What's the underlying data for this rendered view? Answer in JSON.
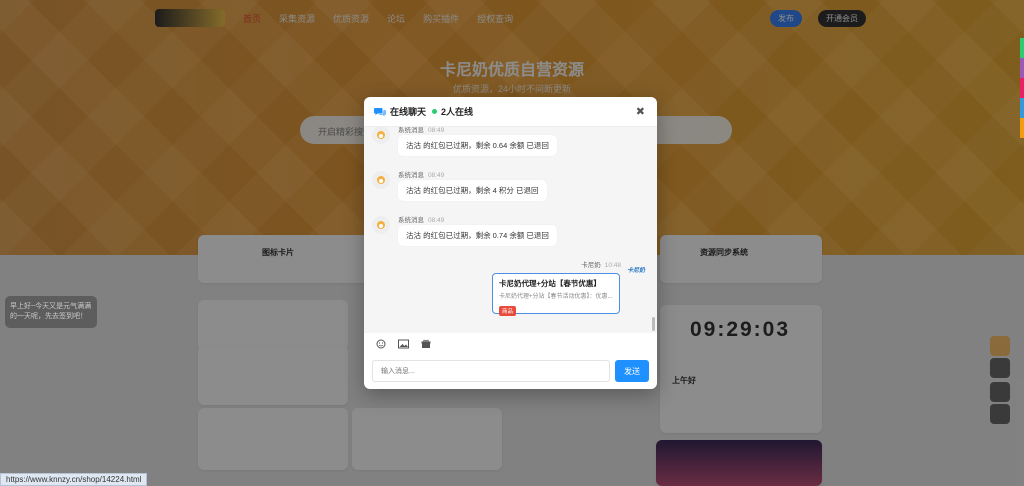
{
  "status_url": "https://www.knnzy.cn/shop/14224.html",
  "background": {
    "hero_title": "卡尼奶优质自营资源",
    "hero_sub": "优质资源，24小时不间断更新",
    "search_placeholder": "开启精彩搜索",
    "left_tip": "早上好~今天又是元气满满的一天呢，先去签到吧！",
    "clock": "09:29:03",
    "card_title_1": "图标卡片",
    "card_title_2": "资源同步系统",
    "greeting": "上午好"
  },
  "chat": {
    "title": "在线聊天",
    "online_text": "2人在线",
    "messages": [
      {
        "sender": "系统消息",
        "time": "08:49",
        "text": "沽沽 的红包已过期，剩余 0.64 余额 已退回"
      },
      {
        "sender": "系统消息",
        "time": "08:49",
        "text": "沽沽 的红包已过期，剩余 4 积分 已退回"
      },
      {
        "sender": "系统消息",
        "time": "08:49",
        "text": "沽沽 的红包已过期，剩余 0.74 余额 已退回"
      }
    ],
    "me": {
      "sender": "卡尼奶",
      "time": "10:48",
      "avatar_label": "卡尼奶"
    },
    "product": {
      "title": "卡尼奶代理+分站【春节优惠】",
      "desc": "卡尼奶代理+分站【春节活动优惠】：优惠...",
      "tag": "商品"
    },
    "input_placeholder": "输入消息...",
    "send_label": "发送"
  },
  "colors": {
    "accent": "#1e90ff",
    "tag": "#e74c3c",
    "online": "#2ecc71"
  }
}
